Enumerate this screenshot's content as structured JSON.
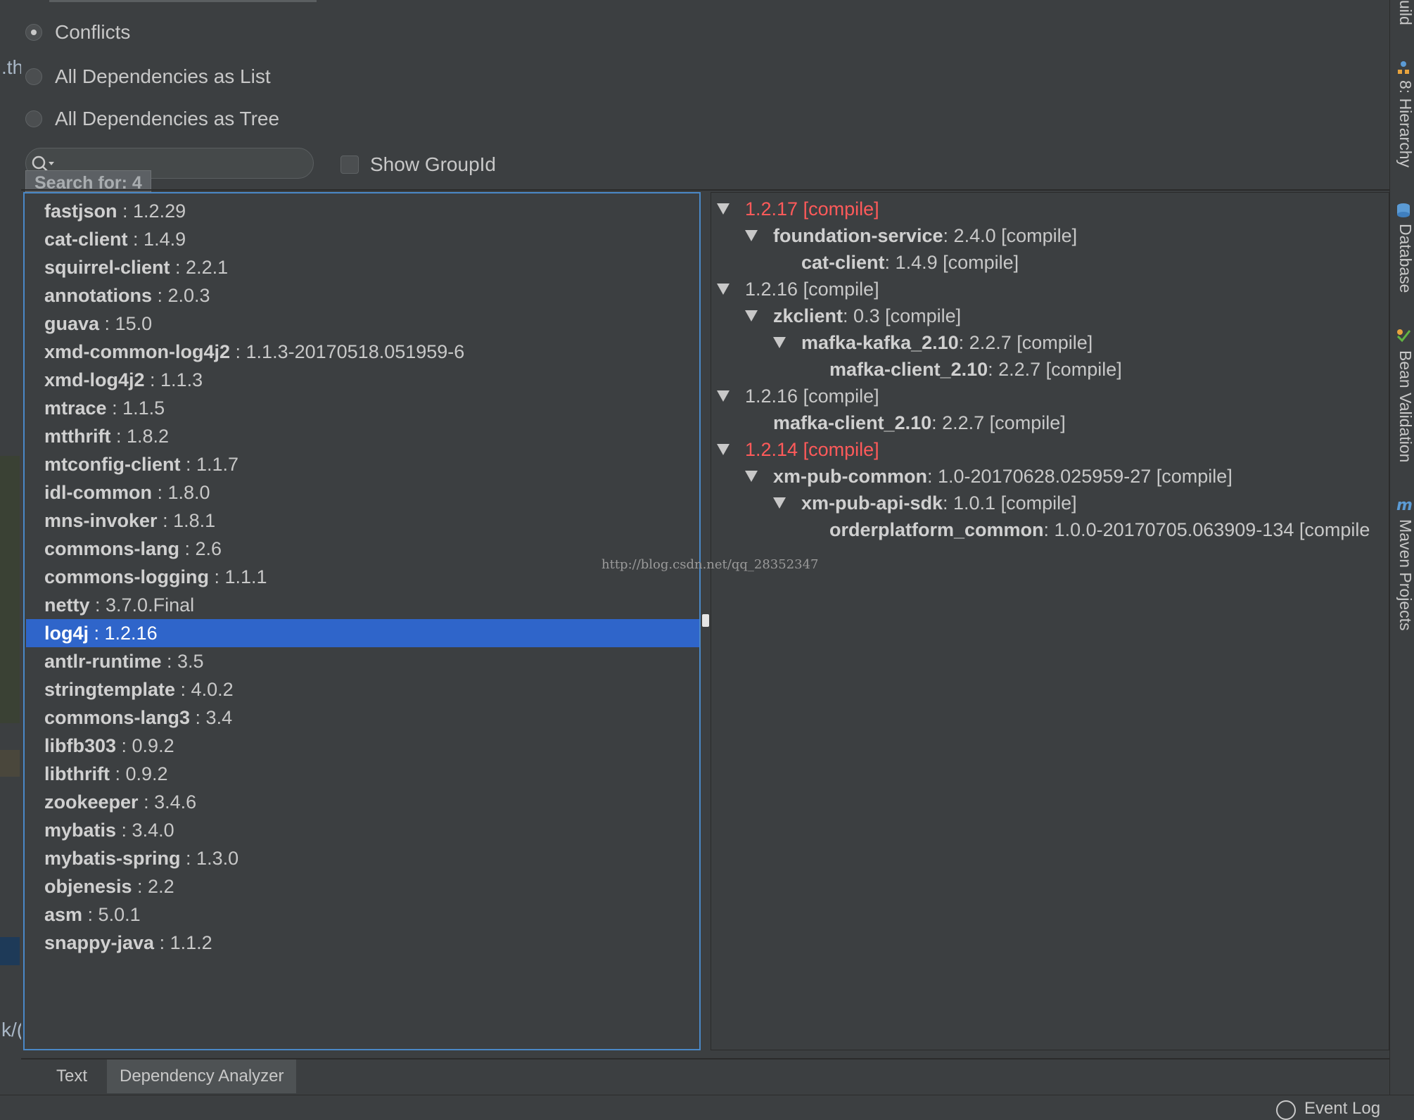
{
  "gutter": {
    "frag_top": ".th",
    "frag_bottom": "k/("
  },
  "options": {
    "conflicts_label": "Conflicts",
    "list_label": "All Dependencies as List",
    "tree_label": "All Dependencies as Tree",
    "selected": "Conflicts"
  },
  "search": {
    "popup_label": "Search for: 4",
    "show_groupid_label": "Show GroupId",
    "show_groupid_checked": false
  },
  "dependencies": [
    {
      "name": "fastjson",
      "version": "1.2.29"
    },
    {
      "name": "cat-client",
      "version": "1.4.9"
    },
    {
      "name": "squirrel-client",
      "version": "2.2.1"
    },
    {
      "name": "annotations",
      "version": "2.0.3"
    },
    {
      "name": "guava",
      "version": "15.0"
    },
    {
      "name": "xmd-common-log4j2",
      "version": "1.1.3-20170518.051959-6"
    },
    {
      "name": "xmd-log4j2",
      "version": "1.1.3"
    },
    {
      "name": "mtrace",
      "version": "1.1.5"
    },
    {
      "name": "mtthrift",
      "version": "1.8.2"
    },
    {
      "name": "mtconfig-client",
      "version": "1.1.7"
    },
    {
      "name": "idl-common",
      "version": "1.8.0"
    },
    {
      "name": "mns-invoker",
      "version": "1.8.1"
    },
    {
      "name": "commons-lang",
      "version": "2.6"
    },
    {
      "name": "commons-logging",
      "version": "1.1.1"
    },
    {
      "name": "netty",
      "version": "3.7.0.Final"
    },
    {
      "name": "log4j",
      "version": "1.2.16",
      "selected": true
    },
    {
      "name": "antlr-runtime",
      "version": "3.5"
    },
    {
      "name": "stringtemplate",
      "version": "4.0.2"
    },
    {
      "name": "commons-lang3",
      "version": "3.4"
    },
    {
      "name": "libfb303",
      "version": "0.9.2"
    },
    {
      "name": "libthrift",
      "version": "0.9.2"
    },
    {
      "name": "zookeeper",
      "version": "3.4.6"
    },
    {
      "name": "mybatis",
      "version": "3.4.0"
    },
    {
      "name": "mybatis-spring",
      "version": "1.3.0"
    },
    {
      "name": "objenesis",
      "version": "2.2"
    },
    {
      "name": "asm",
      "version": "5.0.1"
    },
    {
      "name": "snappy-java",
      "version": "1.1.2"
    }
  ],
  "tree": [
    {
      "depth": 0,
      "expanded": true,
      "version_text": "1.2.17 [compile]",
      "conflict": true
    },
    {
      "depth": 1,
      "expanded": true,
      "name": "foundation-service",
      "version_text": " : 2.4.0 [compile]"
    },
    {
      "depth": 2,
      "expanded": false,
      "name": "cat-client",
      "version_text": " : 1.4.9 [compile]"
    },
    {
      "depth": 0,
      "expanded": true,
      "version_text": "1.2.16 [compile]",
      "conflict": false
    },
    {
      "depth": 1,
      "expanded": true,
      "name": "zkclient",
      "version_text": " : 0.3 [compile]"
    },
    {
      "depth": 2,
      "expanded": true,
      "name": "mafka-kafka_2.10",
      "version_text": " : 2.2.7 [compile]"
    },
    {
      "depth": 3,
      "expanded": false,
      "name": "mafka-client_2.10",
      "version_text": " : 2.2.7 [compile]"
    },
    {
      "depth": 0,
      "expanded": true,
      "version_text": "1.2.16 [compile]",
      "conflict": false
    },
    {
      "depth": 1,
      "expanded": false,
      "name": "mafka-client_2.10",
      "version_text": " : 2.2.7 [compile]"
    },
    {
      "depth": 0,
      "expanded": true,
      "version_text": "1.2.14 [compile]",
      "conflict": true
    },
    {
      "depth": 1,
      "expanded": true,
      "name": "xm-pub-common",
      "version_text": " : 1.0-20170628.025959-27 [compile]"
    },
    {
      "depth": 2,
      "expanded": true,
      "name": "xm-pub-api-sdk",
      "version_text": " : 1.0.1 [compile]"
    },
    {
      "depth": 3,
      "expanded": false,
      "name": "orderplatform_common",
      "version_text": " : 1.0.0-20170705.063909-134 [compile"
    }
  ],
  "watermark": "http://blog.csdn.net/qq_28352347",
  "tabs": [
    "Text",
    "Dependency Analyzer"
  ],
  "active_tab": "Dependency Analyzer",
  "toolwindows": {
    "build": "uild",
    "hierarchy": "8: Hierarchy",
    "database": "Database",
    "bean_validation": "Bean Validation",
    "maven": "Maven Projects"
  },
  "statusbar": {
    "event_log": "Event Log"
  },
  "colors": {
    "background": "#3c3f41",
    "selection": "#2f65ca",
    "focus_border": "#4a88c7",
    "conflict": "#ff5a5a"
  }
}
